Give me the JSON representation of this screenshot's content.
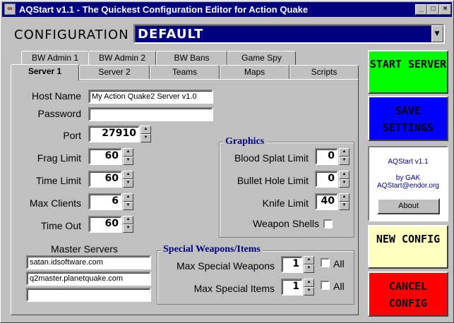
{
  "window": {
    "title": "AQStart v1.1 - The Quickest Configuration Editor for Action Quake",
    "icon": "aq-icon",
    "minimize": "_",
    "maximize": "□",
    "close": "×"
  },
  "config": {
    "label": "CONFIGURATION",
    "selected": "DEFAULT"
  },
  "tabs_back": [
    "BW Admin 1",
    "BW Admin 2",
    "BW Bans",
    "Game Spy"
  ],
  "tabs_front": [
    "Server 1",
    "Server 2",
    "Teams",
    "Maps",
    "Scripts"
  ],
  "server": {
    "host_name_label": "Host Name",
    "host_name": "My Action Quake2 Server v1.0",
    "password_label": "Password",
    "password": "",
    "port_label": "Port",
    "port": "27910",
    "frag_limit_label": "Frag Limit",
    "frag_limit": "60",
    "time_limit_label": "Time Limit",
    "time_limit": "60",
    "max_clients_label": "Max Clients",
    "max_clients": "6",
    "time_out_label": "Time Out",
    "time_out": "60"
  },
  "graphics": {
    "title": "Graphics",
    "blood_label": "Blood Splat Limit",
    "blood": "0",
    "bullet_label": "Bullet Hole Limit",
    "bullet": "0",
    "knife_label": "Knife Limit",
    "knife": "40",
    "shells_label": "Weapon Shells",
    "shells_checked": false
  },
  "master": {
    "title": "Master Servers",
    "servers": [
      "satan.idsoftware.com",
      "q2master.planetquake.com",
      ""
    ]
  },
  "special": {
    "title": "Special Weapons/Items",
    "max_weapons_label": "Max Special Weapons",
    "max_weapons": "1",
    "max_items_label": "Max Special Items",
    "max_items": "1",
    "all_label": "All"
  },
  "buttons": {
    "start": "START SERVER",
    "save": "SAVE SETTINGS",
    "new": "NEW CONFIG",
    "cancel": "CANCEL CONFIG",
    "about": "About"
  },
  "about": {
    "name": "AQStart v1.1",
    "by": "by GAK",
    "email": "AQStart@endor.org"
  },
  "colors": {
    "title_bar": "#000080",
    "start": "#00ff00",
    "save": "#0000ff",
    "new": "#ffffc0",
    "cancel": "#ff0000"
  }
}
